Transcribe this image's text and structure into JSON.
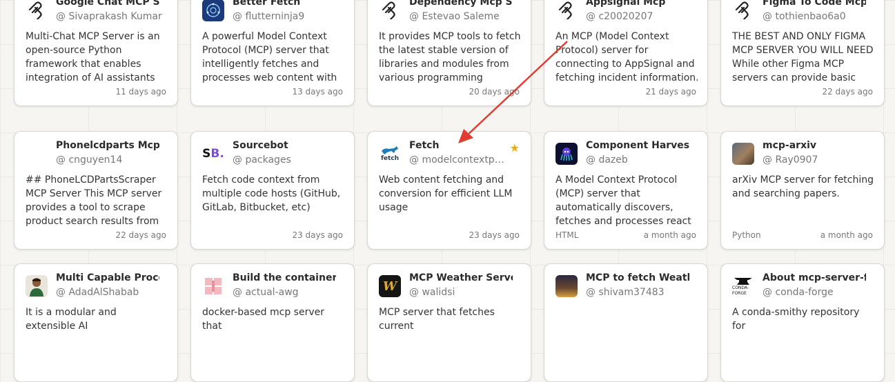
{
  "cards": [
    {
      "title": "Google Chat MCP Server",
      "author": "@ Sivaprakash Kumar",
      "desc": "Multi-Chat MCP Server is an open-source Python framework that enables integration of AI assistants into team chat",
      "time": "11 days ago",
      "lang": "",
      "icon": "mcp-logo-icon"
    },
    {
      "title": "Better Fetch",
      "author": "@ flutterninja9",
      "desc": "A powerful Model Context Protocol (MCP) server that intelligently fetches and processes web content with",
      "time": "13 days ago",
      "lang": "",
      "icon": "network-globe-icon"
    },
    {
      "title": "Dependency Mcp Server",
      "author": "@ Estevao Saleme",
      "desc": "It provides MCP tools to fetch the latest stable version of libraries and modules from various programming language",
      "time": "20 days ago",
      "lang": "",
      "icon": "mcp-logo-icon"
    },
    {
      "title": "Appsignal Mcp",
      "author": "@ c20020207",
      "desc": "An MCP (Model Context Protocol) server for connecting to AppSignal and fetching incident information.",
      "time": "21 days ago",
      "lang": "",
      "icon": "mcp-logo-icon"
    },
    {
      "title": "Figma To Code Mcp By Figma",
      "author": "@ tothienbao6a0",
      "desc": "THE BEST AND ONLY FIGMA MCP SERVER YOU WILL NEED While other Figma MCP servers can provide basic node",
      "time": "22 days ago",
      "lang": "",
      "icon": "mcp-logo-icon"
    },
    {
      "title": "Phonelcdparts Mcp",
      "author": "@ cnguyen14",
      "desc": "## PhoneLCDPartsScraper MCP Server This MCP server provides a tool to scrape product search results from",
      "time": "22 days ago",
      "lang": "",
      "icon": "blank-icon"
    },
    {
      "title": "Sourcebot",
      "author": "@ packages",
      "desc": "Fetch code context from multiple code hosts (GitHub, GitLab, Bitbucket, etc)",
      "time": "23 days ago",
      "lang": "",
      "icon": "sourcebot-logo-icon"
    },
    {
      "title": "Fetch",
      "author": "@ modelcontextprotocol",
      "desc": "Web content fetching and conversion for efficient LLM usage",
      "time": "23 days ago",
      "lang": "",
      "icon": "fetch-dog-icon",
      "starred": true
    },
    {
      "title": "Component Harvester MCP",
      "author": "@ dazeb",
      "desc": "A Model Context Protocol (MCP) server that automatically discovers, fetches and processes react components from popular",
      "time": "a month ago",
      "lang": "HTML",
      "icon": "octopus-avatar-icon"
    },
    {
      "title": "mcp-arxiv",
      "author": "@ Ray0907",
      "desc": "arXiv MCP server for fetching and searching papers.",
      "time": "a month ago",
      "lang": "Python",
      "icon": "photo-avatar-icon"
    },
    {
      "title": "Multi Capable Processing MCP",
      "author": "@ AdadAlShabab",
      "desc": "It is a modular and extensible AI",
      "time": "",
      "lang": "",
      "icon": "person-avatar-icon"
    },
    {
      "title": "Build the container",
      "author": "@ actual-awg",
      "desc": "docker-based mcp server that",
      "time": "",
      "lang": "",
      "icon": "pink-grid-icon"
    },
    {
      "title": "MCP Weather Server",
      "author": "@ walidsi",
      "desc": "MCP server that fetches current",
      "time": "",
      "lang": "",
      "icon": "w-logo-icon"
    },
    {
      "title": "MCP to fetch Weather Data",
      "author": "@ shivam37483",
      "desc": "",
      "time": "",
      "lang": "",
      "icon": "night-photo-icon"
    },
    {
      "title": "About mcp-server-fetch",
      "author": "@ conda-forge",
      "desc": "A conda-smithy repository for",
      "time": "",
      "lang": "",
      "icon": "conda-forge-icon"
    }
  ],
  "colors": {
    "star": "#e8b007",
    "arrow": "#e03c31"
  }
}
